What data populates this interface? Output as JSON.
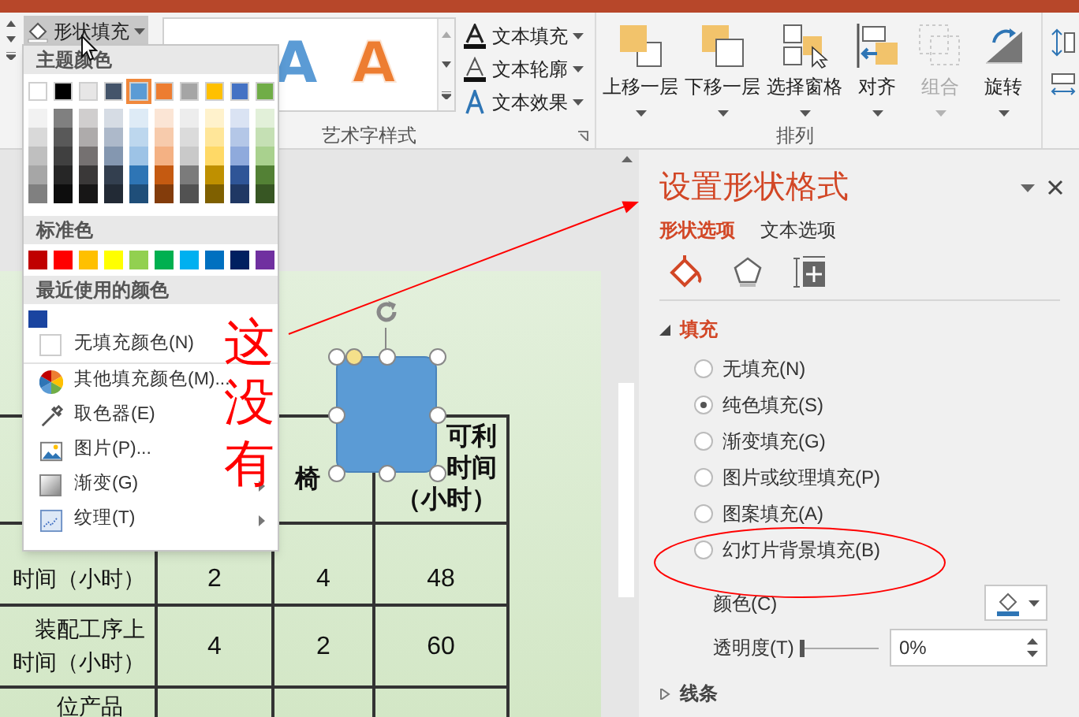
{
  "ribbon": {
    "shape_fill": {
      "label": "形状填充"
    },
    "wordart_styles": [
      {
        "label": "A",
        "kind": "solid",
        "color": "#5b9bd5"
      },
      {
        "label": "A",
        "kind": "outline",
        "color": "#ed7d31"
      }
    ],
    "text_buttons": [
      {
        "kind": "fill",
        "label": "文本填充"
      },
      {
        "kind": "outline",
        "label": "文本轮廓"
      },
      {
        "kind": "effect",
        "label": "文本效果"
      }
    ],
    "wordart_group_label": "艺术字样式",
    "arrange_buttons": [
      {
        "kind": "forward",
        "label": "上移一层",
        "disabled": false
      },
      {
        "kind": "backward",
        "label": "下移一层",
        "disabled": false
      },
      {
        "kind": "pane",
        "label": "选择窗格",
        "disabled": false
      },
      {
        "kind": "align",
        "label": "对齐",
        "disabled": false
      },
      {
        "kind": "group",
        "label": "组合",
        "disabled": true
      },
      {
        "kind": "rotate",
        "label": "旋转",
        "disabled": false
      }
    ],
    "arrange_group_label": "排列"
  },
  "fill_menu": {
    "theme_header": "主题颜色",
    "theme_colors": [
      {
        "color": "#ffffff",
        "selected": false,
        "shades": [
          {
            "color": "#f2f2f2"
          },
          {
            "color": "#d9d9d9"
          },
          {
            "color": "#bfbfbf"
          },
          {
            "color": "#a6a6a6"
          },
          {
            "color": "#808080"
          }
        ]
      },
      {
        "color": "#000000",
        "selected": false,
        "shades": [
          {
            "color": "#808080"
          },
          {
            "color": "#595959"
          },
          {
            "color": "#404040"
          },
          {
            "color": "#262626"
          },
          {
            "color": "#0d0d0d"
          }
        ]
      },
      {
        "color": "#e7e6e6",
        "selected": false,
        "shades": [
          {
            "color": "#d0cece"
          },
          {
            "color": "#aeabab"
          },
          {
            "color": "#757171"
          },
          {
            "color": "#3a3838"
          },
          {
            "color": "#171616"
          }
        ]
      },
      {
        "color": "#44546a",
        "selected": false,
        "shades": [
          {
            "color": "#d6dce4"
          },
          {
            "color": "#adb9ca"
          },
          {
            "color": "#8497b0"
          },
          {
            "color": "#333f4f"
          },
          {
            "color": "#222a35"
          }
        ]
      },
      {
        "color": "#5b9bd5",
        "selected": true,
        "shades": [
          {
            "color": "#deebf6"
          },
          {
            "color": "#bdd7ee"
          },
          {
            "color": "#9dc3e6"
          },
          {
            "color": "#2e75b5"
          },
          {
            "color": "#1f4e79"
          }
        ]
      },
      {
        "color": "#ed7d31",
        "selected": false,
        "shades": [
          {
            "color": "#fbe5d5"
          },
          {
            "color": "#f7cbac"
          },
          {
            "color": "#f4b183"
          },
          {
            "color": "#c55a11"
          },
          {
            "color": "#833c0b"
          }
        ]
      },
      {
        "color": "#a5a5a5",
        "selected": false,
        "shades": [
          {
            "color": "#ededed"
          },
          {
            "color": "#dbdbdb"
          },
          {
            "color": "#c9c9c9"
          },
          {
            "color": "#7b7b7b"
          },
          {
            "color": "#525252"
          }
        ]
      },
      {
        "color": "#ffc000",
        "selected": false,
        "shades": [
          {
            "color": "#fff2cc"
          },
          {
            "color": "#ffe699"
          },
          {
            "color": "#ffd966"
          },
          {
            "color": "#bf9000"
          },
          {
            "color": "#7f6000"
          }
        ]
      },
      {
        "color": "#4472c4",
        "selected": false,
        "shades": [
          {
            "color": "#dae3f3"
          },
          {
            "color": "#b4c7e7"
          },
          {
            "color": "#8faadc"
          },
          {
            "color": "#2f5597"
          },
          {
            "color": "#203864"
          }
        ]
      },
      {
        "color": "#70ad47",
        "selected": false,
        "shades": [
          {
            "color": "#e2f0d9"
          },
          {
            "color": "#c5e0b4"
          },
          {
            "color": "#a9d18e"
          },
          {
            "color": "#538135"
          },
          {
            "color": "#375623"
          }
        ]
      }
    ],
    "standard_header": "标准色",
    "standard_colors": [
      {
        "color": "#c00000"
      },
      {
        "color": "#ff0000"
      },
      {
        "color": "#ffc000"
      },
      {
        "color": "#ffff00"
      },
      {
        "color": "#92d050"
      },
      {
        "color": "#00b050"
      },
      {
        "color": "#00b0f0"
      },
      {
        "color": "#0070c0"
      },
      {
        "color": "#002060"
      },
      {
        "color": "#7030a0"
      }
    ],
    "recent_header": "最近使用的颜色",
    "recent_colors": [
      {
        "color": "#1a44a0"
      }
    ],
    "items": [
      {
        "kind": "no-fill",
        "label": "无填充颜色(N)",
        "submenu": false
      },
      {
        "kind": "more-colors",
        "label": "其他填充颜色(M)...",
        "submenu": false
      },
      {
        "kind": "eyedropper",
        "label": "取色器(E)",
        "submenu": false
      },
      {
        "kind": "picture",
        "label": "图片(P)...",
        "submenu": false
      },
      {
        "kind": "gradient",
        "label": "渐变(G)",
        "submenu": true
      },
      {
        "kind": "texture",
        "label": "纹理(T)",
        "submenu": true
      }
    ]
  },
  "slide": {
    "annotation": "这没有",
    "table": {
      "header": [
        {
          "lines": [
            "椅"
          ]
        },
        {
          "lines": [
            "可利",
            "时间",
            "（小时）"
          ]
        }
      ],
      "rows": [
        [
          {
            "lines": [
              "时间（小时）"
            ]
          },
          {
            "lines": [
              "2"
            ]
          },
          {
            "lines": [
              "4"
            ]
          },
          {
            "lines": [
              "48"
            ]
          }
        ],
        [
          {
            "lines": [
              "装配工序上",
              "时间（小时）"
            ]
          },
          {
            "lines": [
              "4"
            ]
          },
          {
            "lines": [
              "2"
            ]
          },
          {
            "lines": [
              "60"
            ]
          }
        ],
        [
          {
            "lines": [
              "位产品"
            ]
          },
          {},
          {},
          {}
        ]
      ]
    }
  },
  "format_pane": {
    "title": "设置形状格式",
    "tabs": [
      {
        "label": "形状选项",
        "selected": true
      },
      {
        "label": "文本选项",
        "selected": false
      }
    ],
    "icon_tabs": [
      {
        "kind": "fill",
        "selected": true
      },
      {
        "kind": "effects",
        "selected": false
      },
      {
        "kind": "size",
        "selected": false
      }
    ],
    "fill_section": {
      "label": "填充",
      "expanded": true,
      "options": [
        {
          "label": "无填充(N)",
          "selected": false
        },
        {
          "label": "纯色填充(S)",
          "selected": true
        },
        {
          "label": "渐变填充(G)",
          "selected": false
        },
        {
          "label": "图片或纹理填充(P)",
          "selected": false
        },
        {
          "label": "图案填充(A)",
          "selected": false
        },
        {
          "label": "幻灯片背景填充(B)",
          "selected": false
        }
      ],
      "color_label": "颜色(C)",
      "transparency": {
        "label": "透明度(T)",
        "level": 0,
        "value": "0%"
      }
    },
    "line_section": {
      "label": "线条",
      "expanded": false
    }
  }
}
